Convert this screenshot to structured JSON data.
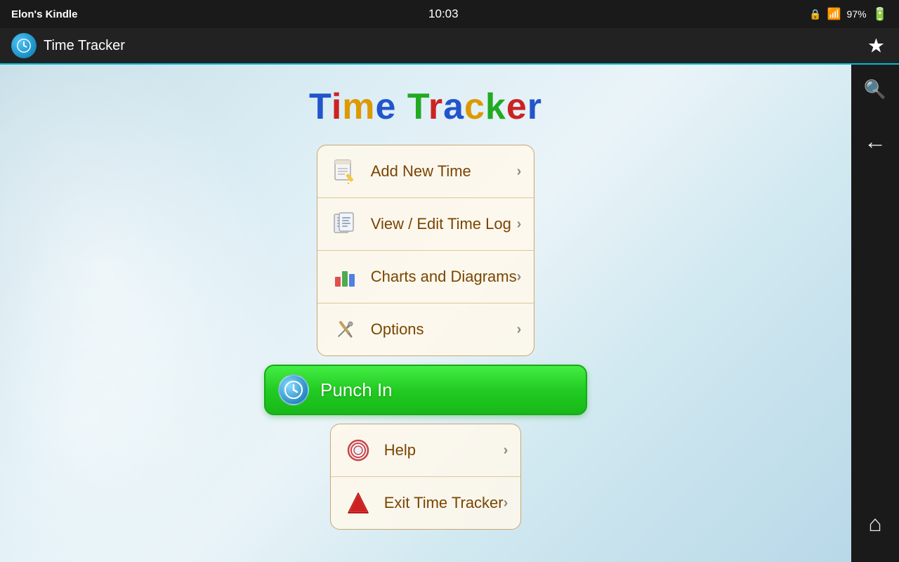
{
  "statusBar": {
    "deviceName": "Elon's Kindle",
    "time": "10:03",
    "batteryPercent": "97%"
  },
  "titleBar": {
    "title": "Time Tracker",
    "starIcon": "★"
  },
  "appTitle": {
    "text": "Time Tracker"
  },
  "menuItems": [
    {
      "id": "add-new-time",
      "label": "Add New Time",
      "icon": "📋"
    },
    {
      "id": "view-edit-time-log",
      "label": "View / Edit Time Log",
      "icon": "📄"
    },
    {
      "id": "charts-and-diagrams",
      "label": "Charts and Diagrams",
      "icon": "📊"
    },
    {
      "id": "options",
      "label": "Options",
      "icon": "🔧"
    }
  ],
  "punchInButton": {
    "label": "Punch In"
  },
  "bottomMenuItems": [
    {
      "id": "help",
      "label": "Help",
      "icon": "🆘"
    },
    {
      "id": "exit-time-tracker",
      "label": "Exit Time Tracker",
      "icon": "🛑"
    }
  ],
  "rightSidebar": {
    "searchIcon": "🔍",
    "backIcon": "←",
    "homeIcon": "⌂"
  },
  "colors": {
    "accent": "#00bcd4",
    "punchInGreen": "#22cc22",
    "menuBorder": "#c8a870",
    "menuText": "#7a4500"
  }
}
